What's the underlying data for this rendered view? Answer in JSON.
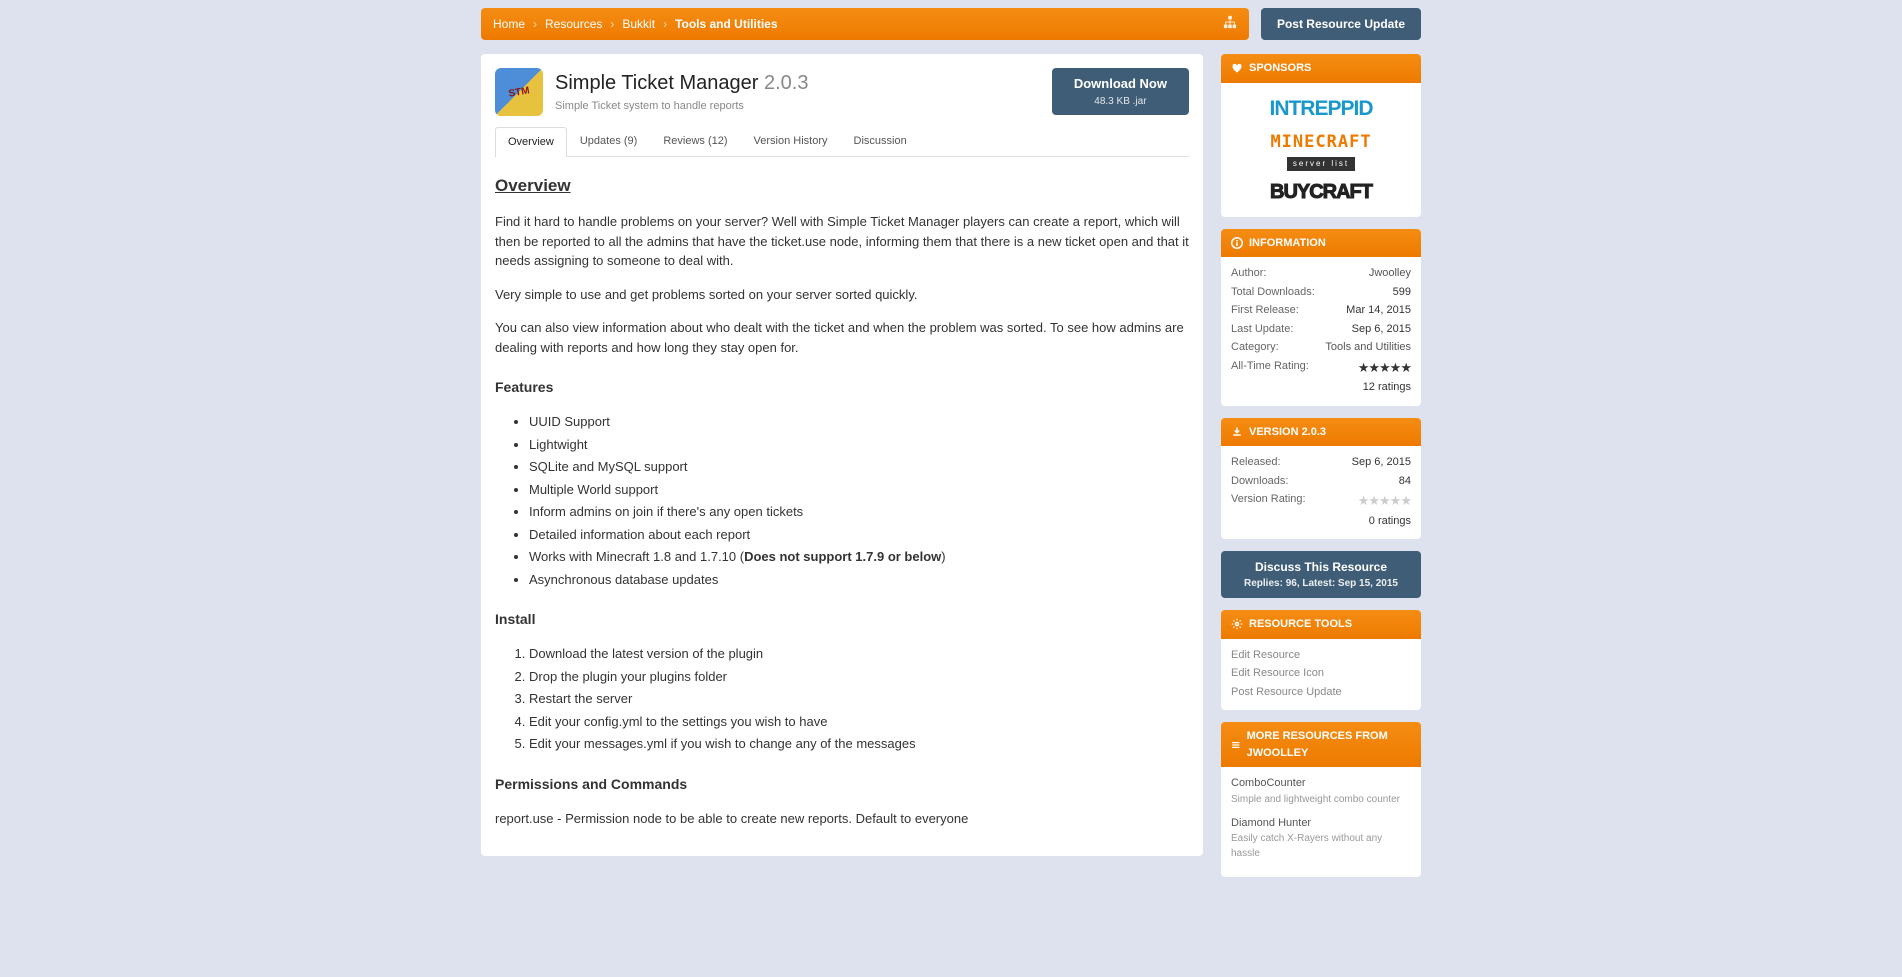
{
  "breadcrumbs": [
    "Home",
    "Resources",
    "Bukkit",
    "Tools and Utilities"
  ],
  "postUpdate": "Post Resource Update",
  "resource": {
    "title": "Simple Ticket Manager",
    "version": "2.0.3",
    "tagline": "Simple Ticket system to handle reports",
    "download": "Download Now",
    "downloadSize": "48.3 KB .jar"
  },
  "tabs": [
    "Overview",
    "Updates (9)",
    "Reviews (12)",
    "Version History",
    "Discussion"
  ],
  "content": {
    "heading": "Overview",
    "p1": "Find it hard to handle problems on your server? Well with Simple Ticket Manager players can create a report, which will then be reported to all the admins that have the ticket.use node, informing them that there is a new ticket open and that it needs assigning to someone to deal with.",
    "p2": "Very simple to use and get problems sorted on your server sorted quickly.",
    "p3": "You can also view information about who dealt with the ticket and when the problem was sorted. To see how admins are dealing with reports and how long they stay open for.",
    "featuresHeading": "Features",
    "features": [
      "UUID Support",
      "Lightwight",
      "SQLite and MySQL support",
      "Multiple World support",
      "Inform admins on join if there's any open tickets",
      "Detailed information about each report",
      "Works with Minecraft 1.8 and 1.7.10 (",
      "Does not support 1.7.9 or below",
      ")",
      "Asynchronous database updates"
    ],
    "installHeading": "Install",
    "install": [
      "Download the latest version of the plugin",
      "Drop the plugin your plugins folder",
      "Restart the server",
      "Edit your config.yml to the settings you wish to have",
      "Edit your messages.yml if you wish to change any of the messages"
    ],
    "permsHeading": "Permissions and Commands",
    "perms1": "report.use - Permission node to be able to create new reports. Default to everyone"
  },
  "side": {
    "sponsors": "SPONSORS",
    "info": {
      "title": "INFORMATION",
      "author_l": "Author:",
      "author": "Jwoolley",
      "downloads_l": "Total Downloads:",
      "downloads": "599",
      "first_l": "First Release:",
      "first": "Mar 14, 2015",
      "last_l": "Last Update:",
      "last": "Sep 6, 2015",
      "cat_l": "Category:",
      "cat": "Tools and Utilities",
      "rating_l": "All-Time Rating:",
      "rating_count": "12 ratings"
    },
    "ver": {
      "title": "VERSION 2.0.3",
      "rel_l": "Released:",
      "rel": "Sep 6, 2015",
      "dl_l": "Downloads:",
      "dl": "84",
      "rating_l": "Version Rating:",
      "rating_count": "0 ratings"
    },
    "discuss": {
      "t": "Discuss This Resource",
      "s": "Replies: 96, Latest: Sep 15, 2015"
    },
    "tools": {
      "title": "RESOURCE TOOLS",
      "items": [
        "Edit Resource",
        "Edit Resource Icon",
        "Post Resource Update"
      ]
    },
    "more": {
      "title": "MORE RESOURCES FROM JWOOLLEY",
      "items": [
        {
          "t": "ComboCounter",
          "s": "Simple and lightweight combo counter"
        },
        {
          "t": "Diamond Hunter",
          "s": "Easily catch X-Rayers without any hassle"
        }
      ]
    }
  }
}
